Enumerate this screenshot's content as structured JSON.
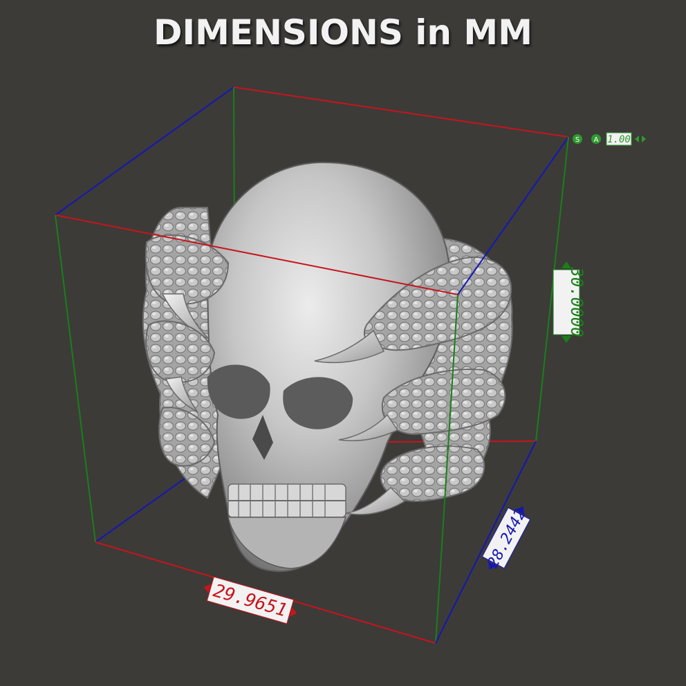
{
  "title": "DIMENSIONS in MM",
  "dimensions": {
    "width": "29.9651",
    "depth": "28.2442",
    "height": "30.0000"
  },
  "scale_widget": {
    "s_label": "S",
    "a_label": "A",
    "value": "1.00"
  },
  "colors": {
    "background": "#3c3b38",
    "x_axis": "#c8141c",
    "y_axis": "#1a7f1a",
    "z_axis": "#1616b4",
    "model": "#bdbdbd"
  }
}
